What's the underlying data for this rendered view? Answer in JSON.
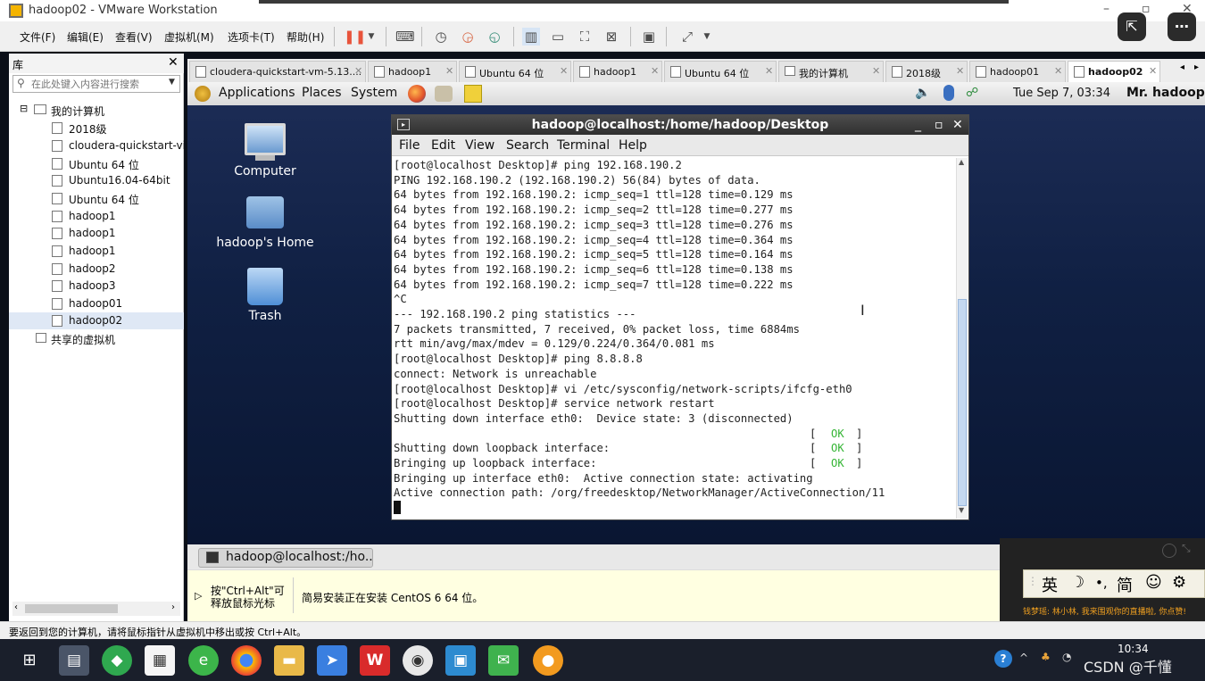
{
  "window": {
    "title": "hadoop02 - VMware Workstation"
  },
  "menubar": [
    "文件(F)",
    "编辑(E)",
    "查看(V)",
    "虚拟机(M)",
    "选项卡(T)",
    "帮助(H)"
  ],
  "toolbar_icons": [
    "pause-icon",
    "dropdown-icon",
    "send-keys-icon",
    "snapshot-icon",
    "revert-snapshot-icon",
    "snapshot-manager-icon",
    "library-view-icon",
    "thumbnail-bar-icon",
    "fullscreen-icon",
    "unity-icon",
    "console-view-icon",
    "stretch-icon"
  ],
  "library": {
    "title": "库",
    "search_placeholder": "在此处键入内容进行搜索",
    "root": "我的计算机",
    "items": [
      "2018级",
      "cloudera-quickstart-vi",
      "Ubuntu 64 位",
      "Ubuntu16.04-64bit",
      "Ubuntu 64 位",
      "hadoop1",
      "hadoop1",
      "hadoop1",
      "hadoop2",
      "hadoop3",
      "hadoop01",
      "hadoop02"
    ],
    "shared": "共享的虚拟机"
  },
  "tabs": [
    {
      "label": "cloudera-quickstart-vm-5.13...."
    },
    {
      "label": "hadoop1"
    },
    {
      "label": "Ubuntu 64 位"
    },
    {
      "label": "hadoop1"
    },
    {
      "label": "Ubuntu 64 位"
    },
    {
      "label": "我的计算机"
    },
    {
      "label": "2018级"
    },
    {
      "label": "hadoop01"
    },
    {
      "label": "hadoop02"
    }
  ],
  "guest": {
    "panel": {
      "menus": [
        "Applications",
        "Places",
        "System"
      ],
      "datetime": "Tue Sep  7, 03:34",
      "user": "Mr. hadoop"
    },
    "desktop_icons": [
      "Computer",
      "hadoop's Home",
      "Trash"
    ],
    "terminal": {
      "title": "hadoop@localhost:/home/hadoop/Desktop",
      "menu": [
        "File",
        "Edit",
        "View",
        "Search",
        "Terminal",
        "Help"
      ],
      "lines": [
        "[root@localhost Desktop]# ping 192.168.190.2",
        "PING 192.168.190.2 (192.168.190.2) 56(84) bytes of data.",
        "64 bytes from 192.168.190.2: icmp_seq=1 ttl=128 time=0.129 ms",
        "64 bytes from 192.168.190.2: icmp_seq=2 ttl=128 time=0.277 ms",
        "64 bytes from 192.168.190.2: icmp_seq=3 ttl=128 time=0.276 ms",
        "64 bytes from 192.168.190.2: icmp_seq=4 ttl=128 time=0.364 ms",
        "64 bytes from 192.168.190.2: icmp_seq=5 ttl=128 time=0.164 ms",
        "64 bytes from 192.168.190.2: icmp_seq=6 ttl=128 time=0.138 ms",
        "64 bytes from 192.168.190.2: icmp_seq=7 ttl=128 time=0.222 ms",
        "^C",
        "--- 192.168.190.2 ping statistics ---",
        "7 packets transmitted, 7 received, 0% packet loss, time 6884ms",
        "rtt min/avg/max/mdev = 0.129/0.224/0.364/0.081 ms",
        "[root@localhost Desktop]# ping 8.8.8.8",
        "connect: Network is unreachable",
        "[root@localhost Desktop]# vi /etc/sysconfig/network-scripts/ifcfg-eth0",
        "[root@localhost Desktop]# service network restart",
        "Shutting down interface eth0:  Device state: 3 (disconnected)",
        "",
        "Shutting down loopback interface:",
        "Bringing up loopback interface:",
        "Bringing up interface eth0:  Active connection state: activating",
        "Active connection path: /org/freedesktop/NetworkManager/ActiveConnection/11"
      ],
      "ok_label": "OK"
    },
    "taskbar_item": "hadoop@localhost:/ho..."
  },
  "hint": {
    "text": "按\"Ctrl+Alt\"可释放鼠标光标",
    "message": "简易安装正在安装 CentOS 6 64 位。"
  },
  "ime": {
    "chars": [
      "英",
      "简"
    ],
    "notice": "钱梦瑶: 林小林, 我来围观你的直播啦, 你点赞!"
  },
  "statusbar": {
    "text": "要返回到您的计算机，请将鼠标指针从虚拟机中移出或按 Ctrl+Alt。"
  },
  "windows_taskbar": {
    "apps": [
      "start-icon",
      "explorer-icon",
      "360-icon",
      "store-icon",
      "browser-green-icon",
      "chrome-icon",
      "folder-icon",
      "feishu-icon",
      "wps-icon",
      "media-icon",
      "vmware-icon",
      "wechat-icon",
      "weiyun-icon"
    ],
    "time": "10:34",
    "watermark": "CSDN @千懂"
  },
  "colors": {
    "terminal_ok": "#35b535",
    "guest_bg": "#102043",
    "vm_tab_active": "#ffffff"
  }
}
